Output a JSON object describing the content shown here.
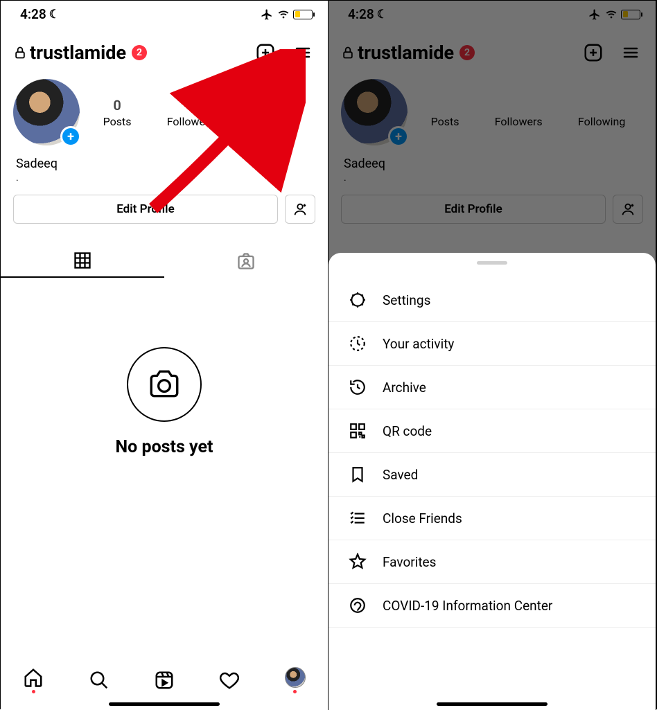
{
  "status": {
    "time": "4:28",
    "moon": "☾",
    "battery_level_pct": 25,
    "battery_color": "#ffcc00"
  },
  "header": {
    "username": "trustlamide",
    "notif_count": "2"
  },
  "stats": {
    "posts_num": "0",
    "posts_label": "Posts",
    "followers_label": "Followers",
    "following_label": "Following"
  },
  "profile": {
    "display_name": "Sadeeq",
    "dot": ".",
    "edit_label": "Edit Profile"
  },
  "empty": {
    "text": "No posts yet"
  },
  "menu": {
    "items": [
      {
        "icon": "settings",
        "label": "Settings"
      },
      {
        "icon": "activity",
        "label": "Your activity"
      },
      {
        "icon": "archive",
        "label": "Archive"
      },
      {
        "icon": "qrcode",
        "label": "QR code"
      },
      {
        "icon": "saved",
        "label": "Saved"
      },
      {
        "icon": "closefriends",
        "label": "Close Friends"
      },
      {
        "icon": "favorites",
        "label": "Favorites"
      },
      {
        "icon": "covid",
        "label": "COVID-19 Information Center"
      }
    ]
  },
  "colors": {
    "accent_blue": "#0095f6",
    "notif_red": "#ff3040"
  }
}
